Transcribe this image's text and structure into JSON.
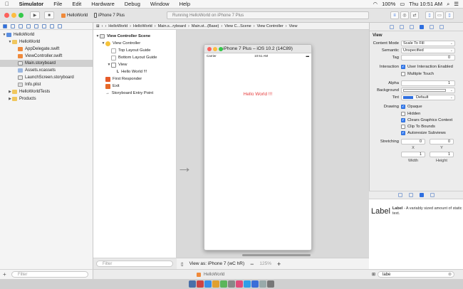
{
  "menubar": {
    "apple": "",
    "app": "Simulator",
    "items": [
      "File",
      "Edit",
      "Hardware",
      "Debug",
      "Window",
      "Help"
    ],
    "battery": "100%",
    "clock": "Thu 10:51 AM"
  },
  "toolbar": {
    "scheme": "HelloWorld",
    "device": "iPhone 7 Plus",
    "activity": "Running HelloWorld on iPhone 7 Plus"
  },
  "navigator": {
    "items": [
      {
        "label": "HelloWorld",
        "indent": 0,
        "disc": "▼",
        "icon": "proj"
      },
      {
        "label": "HelloWorld",
        "indent": 1,
        "disc": "▼",
        "icon": "folder"
      },
      {
        "label": "AppDelegate.swift",
        "indent": 2,
        "disc": "",
        "icon": "swift"
      },
      {
        "label": "ViewController.swift",
        "indent": 2,
        "disc": "",
        "icon": "swift"
      },
      {
        "label": "Main.storyboard",
        "indent": 2,
        "disc": "",
        "icon": "sb",
        "selected": true
      },
      {
        "label": "Assets.xcassets",
        "indent": 2,
        "disc": "",
        "icon": "assets"
      },
      {
        "label": "LaunchScreen.storyboard",
        "indent": 2,
        "disc": "",
        "icon": "sb"
      },
      {
        "label": "Info.plist",
        "indent": 2,
        "disc": "",
        "icon": "plist"
      },
      {
        "label": "HelloWorldTests",
        "indent": 1,
        "disc": "▶",
        "icon": "folder"
      },
      {
        "label": "Products",
        "indent": 1,
        "disc": "▶",
        "icon": "folder"
      }
    ],
    "filter_placeholder": "Filter"
  },
  "jumpbar": [
    "HelloWorld",
    "HelloWorld",
    "Main.s...ryboard",
    "Main.st...(Base)",
    "View C...Scene",
    "View Controller",
    "View"
  ],
  "outline": {
    "items": [
      {
        "label": "View Controller Scene",
        "indent": 0,
        "disc": "▼",
        "icon": "scene",
        "bold": true
      },
      {
        "label": "View Controller",
        "indent": 1,
        "disc": "▼",
        "icon": "vc"
      },
      {
        "label": "Top Layout Guide",
        "indent": 2,
        "disc": "",
        "icon": "guide"
      },
      {
        "label": "Bottom Layout Guide",
        "indent": 2,
        "disc": "",
        "icon": "guide"
      },
      {
        "label": "View",
        "indent": 2,
        "disc": "▼",
        "icon": "view"
      },
      {
        "label": "Hello World !!!",
        "indent": 3,
        "disc": "",
        "icon": "L"
      },
      {
        "label": "First Responder",
        "indent": 1,
        "disc": "",
        "icon": "fr"
      },
      {
        "label": "Exit",
        "indent": 1,
        "disc": "",
        "icon": "ex"
      },
      {
        "label": "Storyboard Entry Point",
        "indent": 1,
        "disc": "",
        "icon": "arrow"
      }
    ],
    "filter_placeholder": "Filter"
  },
  "simulator": {
    "title": "iPhone 7 Plus – iOS 10.2 (14C89)",
    "carrier": "Carrier",
    "time": "10:51 AM",
    "label": "Hello World !!!",
    "label_color": "#e53c3c"
  },
  "canvas_bottom": {
    "view_as": "View as: iPhone 7 (wC hR)",
    "zoom": "125%"
  },
  "debug": {
    "target": "HelloWorld"
  },
  "inspector": {
    "header": "View",
    "content_mode_label": "Content Mode",
    "content_mode": "Scale To Fill",
    "semantic_label": "Semantic",
    "semantic": "Unspecified",
    "tag_label": "Tag",
    "tag": "0",
    "interaction_label": "Interaction",
    "user_interaction": "User Interaction Enabled",
    "multiple_touch": "Multiple Touch",
    "alpha_label": "Alpha",
    "alpha": "1",
    "background_label": "Background",
    "tint_label": "Tint",
    "tint": "Default",
    "drawing_label": "Drawing",
    "opaque": "Opaque",
    "hidden": "Hidden",
    "clears": "Clears Graphics Context",
    "clip": "Clip To Bounds",
    "autoresize": "Autoresize Subviews",
    "stretching_label": "Stretching",
    "x_val": "0",
    "y_val": "0",
    "x_label": "X",
    "y_label": "Y",
    "w_val": "1",
    "h_val": "1",
    "w_label": "Width",
    "h_label": "Height"
  },
  "library": {
    "item_title": "Label",
    "item_desc_bold": "Label",
    "item_desc": " - A variably sized amount of static text.",
    "search": "labe"
  }
}
